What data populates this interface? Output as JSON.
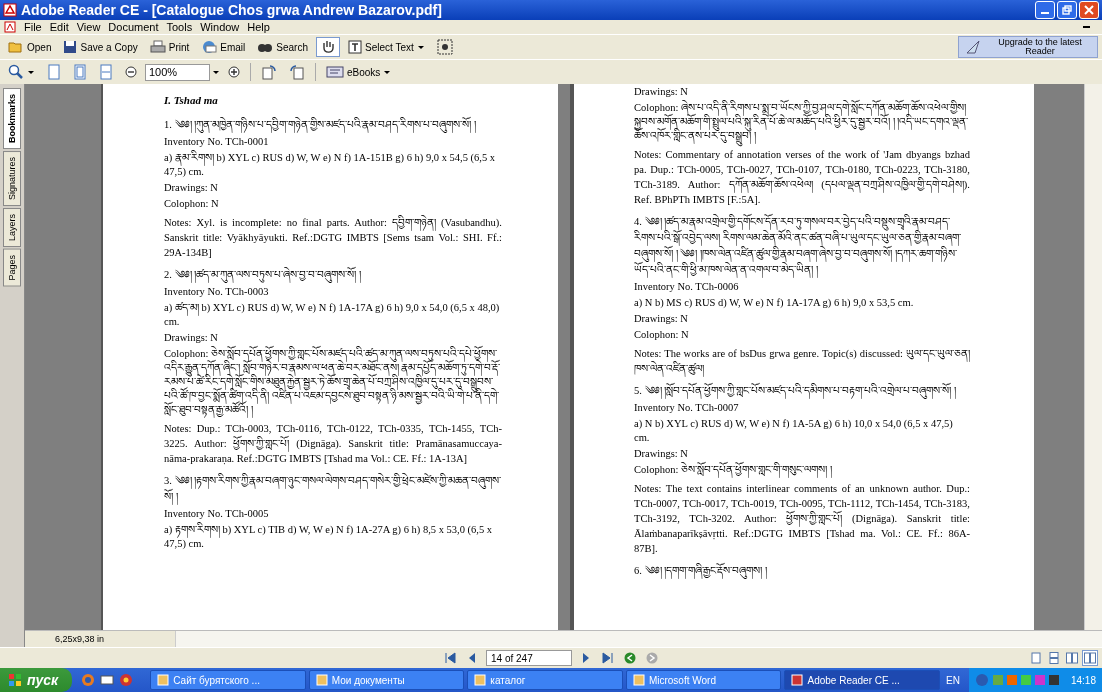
{
  "window": {
    "title": "Adobe Reader CE - [Catalogue Chos grwa Andrew Bazarov.pdf]"
  },
  "menu": [
    "File",
    "Edit",
    "View",
    "Document",
    "Tools",
    "Window",
    "Help"
  ],
  "toolbar": [
    {
      "kind": "open",
      "label": "Open"
    },
    {
      "kind": "save",
      "label": "Save a Copy"
    },
    {
      "kind": "print",
      "label": "Print"
    },
    {
      "kind": "email",
      "label": "Email"
    },
    {
      "kind": "search",
      "label": "Search"
    },
    {
      "kind": "hand"
    },
    {
      "kind": "select",
      "label": "Select Text"
    },
    {
      "kind": "snapshot"
    }
  ],
  "upgrade": {
    "label": "Upgrade to the latest Reader"
  },
  "zoom": {
    "value": "100%"
  },
  "ebooks": {
    "label": "eBooks"
  },
  "side_tabs": [
    {
      "label": "Bookmarks",
      "selected": true
    },
    {
      "label": "Signatures",
      "selected": false
    },
    {
      "label": "Layers",
      "selected": false
    },
    {
      "label": "Pages",
      "selected": false
    }
  ],
  "left_page": [
    {
      "kind": "section",
      "text": "I. Tshad ma"
    },
    {
      "kind": "title",
      "text": "1. ༄༅། །ཀུན་མཁྱེན་གཉིས་པ་དབྱིག་གཉེན་གྱིས་མཛད་པའི་རྣམ་བཤད་རིགས་པ་བཞུགས་སོ། །"
    },
    {
      "kind": "line",
      "text": "Inventory No. TCh-0001"
    },
    {
      "kind": "line",
      "text": "a) རྣམ་རིགས། b) XYL c) RUS d) W, W e) N f) 1A-151B g) 6 h) 9,0 x 54,5 (6,5 x 47,5) cm."
    },
    {
      "kind": "line",
      "text": "Drawings: N"
    },
    {
      "kind": "line",
      "text": "Colophon: N"
    },
    {
      "kind": "para",
      "text": "Notes: Xyl. is incomplete: no final parts. Author: དབྱིག་གཉེན། (Vasubandhu). Sanskrit title: Vyākhyāyukti. Ref.:DGTG IMBTS [Sems tsam Vol.: SHI. Ff.: 29A-134B]"
    },
    {
      "kind": "title",
      "text": "2. ༄༅། །ཚད་མ་ཀུན་ལས་བཏུས་པ་ཞེས་བྱ་བ་བཞུགས་སོ། །"
    },
    {
      "kind": "line",
      "text": "Inventory No. TCh-0003"
    },
    {
      "kind": "line",
      "text": "a) ཚད་མ། b) XYL c) RUS d) W, W e) N f) 1A-17A g) 6 h) 9,0 x 54,0 (6,5 x 48,0) cm."
    },
    {
      "kind": "line",
      "text": "Drawings: N"
    },
    {
      "kind": "line",
      "text": "Colophon: ཅེས་སློབ་དཔོན་ཕྱོགས་ཀྱི་གླང་པོས་མཛད་པའི་ཚད་མ་ཀུན་ལས་བཏུས་པའི་དཔེ་ཕྱོགས་འདིར་རྒྱུན་དཀོན་ཞིང་། སློབ་གཉེར་བ་རྣམས་ལ་ཕན་ཆེ་བར་མཐོང་ནས། རྣམ་དཔྱོད་མཆོག་ཏུ་དགེ་བ་རྡོ་རམས་པ་ཚེ་རིང་དགེ་སློང་གིས་མཐུན་རྐྱེན་སྦྱར་ཏེ་ཆོས་གྲྭ་ཆེན་པོ་བཀྲ་ཤིས་འཁྱིལ་དུ་པར་དུ་བསྒྲུབས་པའི་ཚོ་ཁ་བྱང་སྨོན་ཚིག་འདི་ནི། འཛིན་པ་འཇམ་དབྱངས་ཐུབ་བསྟན་ཉི་མས་སྦྱར་བའི་ཡི་གེ་པ་ནི་དགེ་སློང་ཐུབ་བསྟན་རྒྱ་མཚོའོ། །"
    },
    {
      "kind": "para",
      "text": "Notes: Dup.: TCh-0003, TCh-0116, TCh-0122, TCh-0335, TCh-1455, TCh-3225. Author: ཕྱོགས་ཀྱི་གླང་པོ། (Dignāga). Sanskrit title: Pramānasamuccaya-nāma-prakaraṇa. Ref.:DGTG IMBTS [Tshad ma Vol.: CE. Ff.: 1A-13A]"
    },
    {
      "kind": "title",
      "text": "3. ༄༅། །རྟགས་རིགས་ཀྱི་རྣམ་བཞག་ཉུང་གསལ་ལེགས་བཤད་གསེར་གྱི་ཕྲེང་མཛེས་ཀྱི་མཆན་བཞུགས་སོ། །"
    },
    {
      "kind": "line",
      "text": "Inventory No. TCh-0005"
    },
    {
      "kind": "line",
      "text": "a) རྟགས་རིགས། b) XYL c) TIB d) W, W e) N f) 1A-27A g) 6 h) 8,5 x 53,0 (6,5 x 47,5) cm."
    }
  ],
  "right_page": [
    {
      "kind": "line",
      "text": "Drawings: N"
    },
    {
      "kind": "line",
      "text": "Colophon: ཞེས་པ་འདི་ནི་རིགས་པ་སྨྲ་བ་ཡོངས་ཀྱི་བྱ་ཤལ་དགེ་སློང་དཀོན་མཆོག་ཆོས་འཕེལ་གྱིས། སྐྱབས་མགོན་མཆོག་གི་སྤྲུལ་པའི་སྐུ་རིན་པོ་ཆེ་ལ་མཆོད་པའི་ཕྱིར་དུ་སྦྱར་བའོ། ། །འདི་ཡང་དགའ་ལྡན་ཆོས་འཁོར་གླིང་ནས་པར་དུ་བསྒྲུབ། །"
    },
    {
      "kind": "para",
      "text": "Notes: Commentary of annotation verses of the work of 'Jam dbyangs bzhad pa. Dup.: TCh-0005, TCh-0027, TCh-0107, TCh-0180, TCh-0223, TCh-3180, TCh-3189. Author: དཀོན་མཆོག་ཆོས་འཕེལ། (དཔལ་ལྡན་བཀྲ་ཤིས་འཁྱིལ་གྱི་དགེ་བཤེས།). Ref. BPhPTh IMBTS [F.:5A]."
    },
    {
      "kind": "title",
      "text": "4. ༄༅། །ཚད་མ་རྣམ་འགྲེལ་གྱི་དགོངས་དོན་རབ་ཏུ་གསལ་བར་བྱེད་པའི་བསྡུས་གྲྭའི་རྣམ་བཤད་རིགས་པའི་སྒོ་འབྱེད་ལས། རིགས་ལམ་ཆེན་མོའི་ནང་ཚན་བཞི་པ་ཡུལ་དང་ཡུལ་ཅན་གྱི་རྣམ་བཞག་བཞུགས་སོ། ། ༄༅། །ཁས་ལེན་འཛིན་ཚུལ་གྱི་རྣམ་བཞག་ཞེས་བྱ་བ་བཞུགས་སོ། །དཀར་ཆག་གཉིས་ཡོད་པའི་ནང་གི་ཕྱི་མ་ཁས་ལེན་ན་འགལ་བ་མེད་ཡིན། །"
    },
    {
      "kind": "line",
      "text": "Inventory No. TCh-0006"
    },
    {
      "kind": "line",
      "text": "a) N b) MS c) RUS d) W, W e) N f) 1A-17A g) 6 h) 9,0 x 53,5 cm."
    },
    {
      "kind": "line",
      "text": "Drawings: N"
    },
    {
      "kind": "line",
      "text": "Colophon: N"
    },
    {
      "kind": "para",
      "text": "Notes: The works are of bsDus grwa genre. Topic(s) discussed: ཡུལ་དང་ཡུལ་ཅན། ཁས་ལེན་འཛིན་ཚུལ།"
    },
    {
      "kind": "title",
      "text": "5. ༄༅། །སློབ་དཔོན་ཕྱོགས་ཀྱི་གླང་པོས་མཛད་པའི་དམིགས་པ་བརྟག་པའི་འགྲེལ་པ་བཞུགས་སོ། །"
    },
    {
      "kind": "line",
      "text": "Inventory No. TCh-0007"
    },
    {
      "kind": "line",
      "text": "a) N b) XYL c) RUS d) W, W e) N f) 1A-5A g) 6 h) 10,0 x 54,0 (6,5 x 47,5) cm."
    },
    {
      "kind": "line",
      "text": "Drawings: N"
    },
    {
      "kind": "line",
      "text": "Colophon: ཅེས་སློབ་དཔོན་ཕྱོགས་གླང་གི་གསུང་ལགས། །"
    },
    {
      "kind": "para",
      "text": "Notes: The text contains interlinear comments of an unknown author. Dup.: TCh-0007, TCh-0017, TCh-0019, TCh-0095, TCh-1112, TCh-1454, TCh-3183, TCh-3192, TCh-3202. Author: ཕྱོགས་ཀྱི་གླང་པོ། (Dignāga). Sanskrit title: Ālaṁbanaparīkṣāvṛtti. Ref.:DGTG IMBTS [Tshad ma. Vol.: CE. Ff.: 86A-87B]."
    },
    {
      "kind": "title",
      "text": "6. ༄༅། །དགག་གཞི་རྒྱང་རྡོས་བཞུགས། །"
    }
  ],
  "status": {
    "page_size": "6,25x9,38 in",
    "page": "14 of 247"
  },
  "taskbar": {
    "start": "пуск",
    "tasks": [
      {
        "label": "Сайт бурятского ...",
        "selected": false
      },
      {
        "label": "Мои документы",
        "selected": false
      },
      {
        "label": "каталог",
        "selected": false
      },
      {
        "label": "Microsoft Word",
        "selected": false
      },
      {
        "label": "Adobe Reader CE ...",
        "selected": true
      }
    ],
    "lang": "EN",
    "clock": "14:18"
  }
}
